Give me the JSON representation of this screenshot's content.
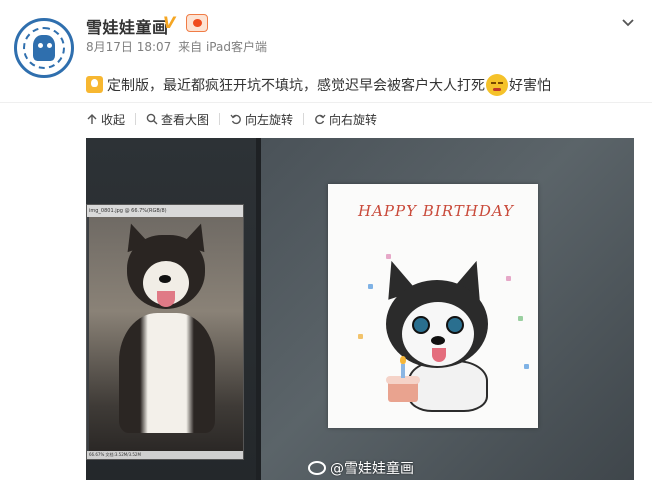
{
  "user": {
    "name": "雪娃娃童画",
    "verified_mark": "V",
    "timestamp": "8月17日 18:07",
    "source": "来自 iPad客户端"
  },
  "post": {
    "text_before": "定制版，最近都疯狂开坑不填坑，感觉迟早会被客户大人打死",
    "text_after": "好害怕",
    "emoji_name": "fearful-face"
  },
  "toolbar": {
    "collapse": "收起",
    "view_large": "查看大图",
    "rotate_left": "向左旋转",
    "rotate_right": "向右旋转"
  },
  "image": {
    "ps_title": "img_0801.jpg @ 66.7%(RGB/8)",
    "ps_status": "66.67%   文档:3.52M/3.52M",
    "card_title": "HAPPY BIRTHDAY",
    "watermark": "@雪娃娃童画"
  },
  "colors": {
    "accent_blue": "#2f6fae",
    "verified_orange": "#f5a623",
    "card_text_red": "#c94a3a"
  }
}
